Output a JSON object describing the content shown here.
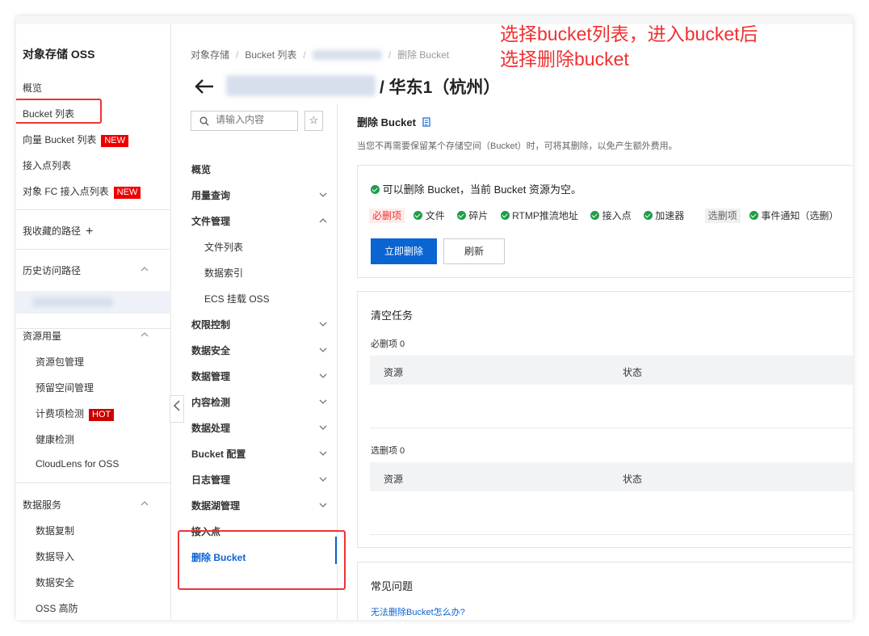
{
  "sidebar": {
    "title": "对象存储 OSS",
    "items": [
      "概览",
      "Bucket 列表",
      "向量 Bucket 列表",
      "接入点列表",
      "对象 FC 接入点列表"
    ],
    "new_tag": "NEW",
    "favorites": "我收藏的路径",
    "history": "历史访问路径",
    "usage_title": "资源用量",
    "usage_items": [
      "资源包管理",
      "预留空间管理",
      "计费项检测",
      "健康检测",
      "CloudLens for OSS"
    ],
    "hot_tag": "HOT",
    "service_title": "数据服务",
    "service_items": [
      "数据复制",
      "数据导入",
      "数据安全",
      "OSS 高防"
    ]
  },
  "breadcrumb": [
    "对象存储",
    "Bucket 列表",
    "删除 Bucket"
  ],
  "header": {
    "region": "/ 华东1（杭州）"
  },
  "search": {
    "placeholder": "请输入内容"
  },
  "submenu": [
    "概览",
    "用量查询",
    "文件管理",
    "文件列表",
    "数据索引",
    "ECS 挂载 OSS",
    "权限控制",
    "数据安全",
    "数据管理",
    "内容检测",
    "数据处理",
    "Bucket 配置",
    "日志管理",
    "数据湖管理",
    "接入点",
    "删除 Bucket"
  ],
  "content": {
    "title": "删除 Bucket",
    "desc": "当您不再需要保留某个存储空间（Bucket）时，可将其删除，以免产生额外费用。",
    "status": "可以删除 Bucket，当前 Bucket 资源为空。",
    "required_label": "必删项",
    "required": [
      "文件",
      "碎片",
      "RTMP推流地址",
      "接入点",
      "加速器"
    ],
    "optional_label": "选删项",
    "optional": [
      "事件通知（选删）"
    ],
    "delete_btn": "立即删除",
    "refresh_btn": "刷新",
    "task_title": "清空任务",
    "req_count": "必删项 0",
    "opt_count": "选删项 0",
    "col_resource": "资源",
    "col_status": "状态",
    "faq_title": "常见问题",
    "faq_link": "无法删除Bucket怎么办?"
  },
  "annotation": {
    "line1": "选择bucket列表，进入bucket后",
    "line2": "选择删除bucket"
  },
  "colors": {
    "primary": "#0a64d2",
    "annotation": "#f03030",
    "ok": "#1e9e4a"
  }
}
